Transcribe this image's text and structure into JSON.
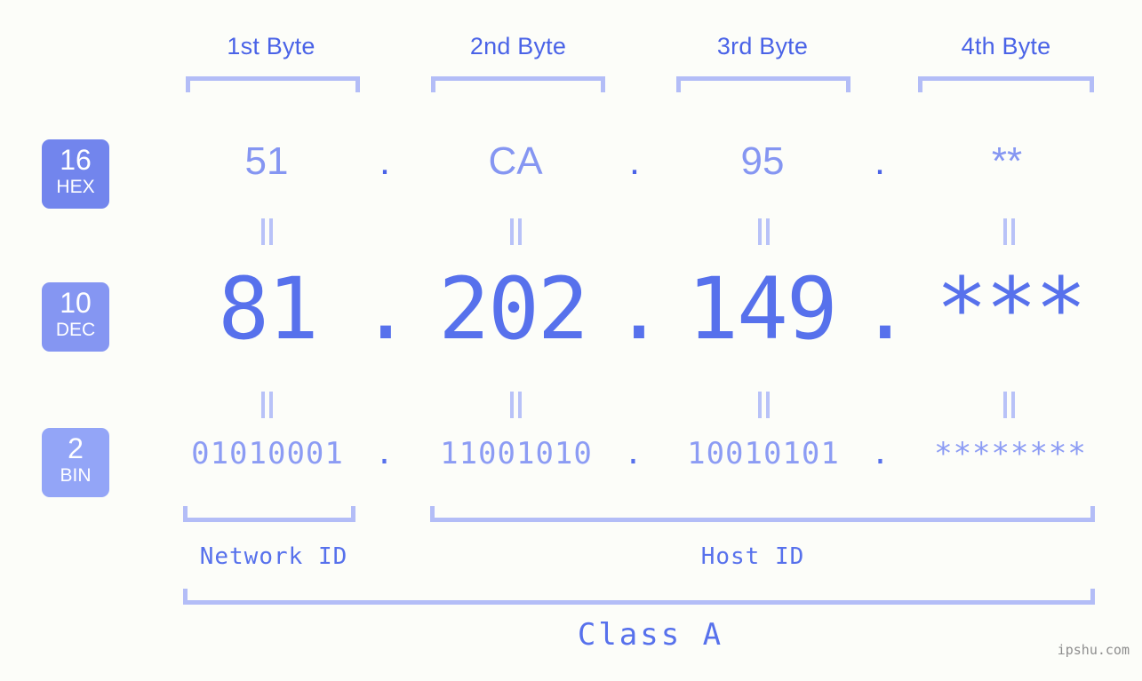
{
  "page": {
    "background_color": "#fcfdf9",
    "accent_color": "#5771ec",
    "bracket_color": "#b3bdf7",
    "watermark": "ipshu.com"
  },
  "byte_headers": [
    {
      "label": "1st Byte"
    },
    {
      "label": "2nd Byte"
    },
    {
      "label": "3rd Byte"
    },
    {
      "label": "4th Byte"
    }
  ],
  "bases": [
    {
      "number": "16",
      "name": "HEX",
      "color": "#7285ed"
    },
    {
      "number": "10",
      "name": "DEC",
      "color": "#8596f2"
    },
    {
      "number": "2",
      "name": "BIN",
      "color": "#93a5f7"
    }
  ],
  "rows": {
    "hex": {
      "base_number": "16",
      "base_name": "HEX",
      "values": [
        "51",
        "CA",
        "95",
        "**"
      ],
      "separators": [
        ".",
        ".",
        "."
      ]
    },
    "dec": {
      "base_number": "10",
      "base_name": "DEC",
      "values": [
        "81",
        "202",
        "149",
        "***"
      ],
      "separators": [
        ".",
        ".",
        "."
      ]
    },
    "bin": {
      "base_number": "2",
      "base_name": "BIN",
      "values": [
        "01010001",
        "11001010",
        "10010101",
        "********"
      ],
      "separators": [
        ".",
        ".",
        "."
      ]
    }
  },
  "equality_marks": {
    "glyph": "=",
    "count_per_gap": 4
  },
  "sections": {
    "network_id": "Network ID",
    "host_id": "Host ID",
    "class": "Class A"
  }
}
